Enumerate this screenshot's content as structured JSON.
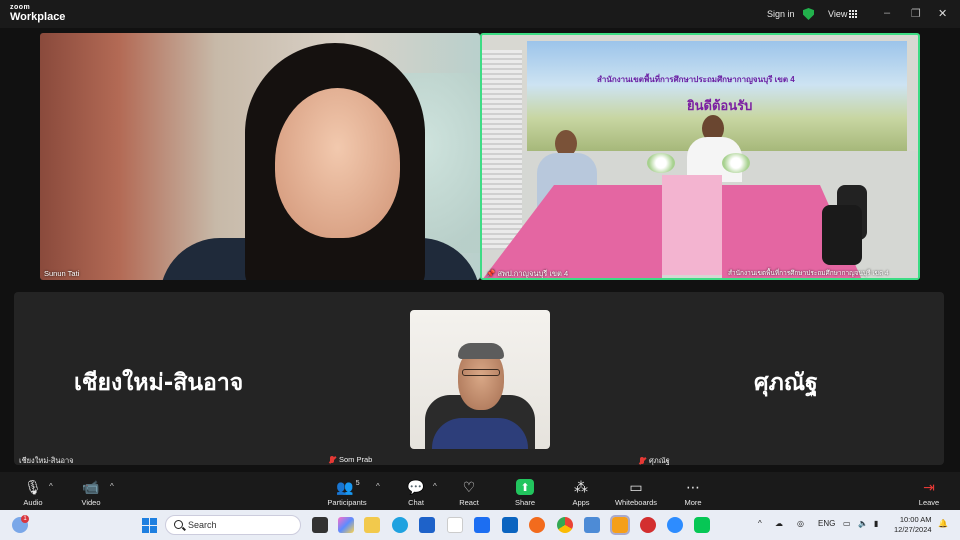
{
  "app": {
    "brand_top": "zoom",
    "brand_bottom": "Workplace"
  },
  "header": {
    "signin_label": "Sign in",
    "view_label": "View",
    "security_color": "#22b14c"
  },
  "participants": {
    "top_left": {
      "name": "Sunun Tati"
    },
    "top_right": {
      "name": "สพป.กาญจนบุรี เขต 4",
      "banner_line1": "สำนักงานเขตพื้นที่การศึกษาประถมศึกษากาญจนบุรี เขต 4",
      "banner_line2": "ยินดีต้อนรับ",
      "caption": "สำนักงานเขตพื้นที่การศึกษาประถมศึกษากาญจนบุรี เขต 4",
      "active_speaker_color": "#3ddc84"
    },
    "bottom_left": {
      "display": "เชียงใหม่-สินอาจ",
      "name": "เชียงใหม่-สินอาจ"
    },
    "bottom_center": {
      "name": "Som Prab"
    },
    "bottom_right": {
      "display": "ศุภณัฐ",
      "name": "ศุภณัฐ"
    }
  },
  "toolbar": {
    "audio": "Audio",
    "video": "Video",
    "participants": "Participants",
    "participants_count": "5",
    "chat": "Chat",
    "react": "React",
    "share": "Share",
    "apps": "Apps",
    "whiteboards": "Whiteboards",
    "more": "More",
    "leave": "Leave"
  },
  "taskbar": {
    "search_placeholder": "Search",
    "language": "ENG",
    "time": "10:00 AM",
    "date": "12/27/2024",
    "weather_badge": "1"
  }
}
